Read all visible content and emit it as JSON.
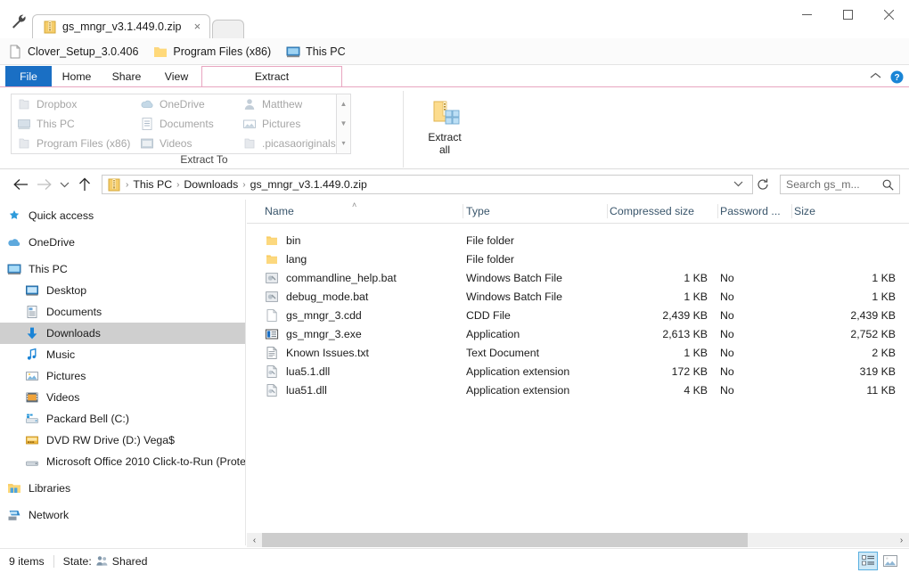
{
  "window": {
    "tab": {
      "title": "gs_mngr_v3.1.449.0.zip",
      "icon": "zip-icon",
      "close_label": "×"
    },
    "tools_icon": "wrench-icon",
    "new_tab_label": "",
    "controls": {
      "minimize": "minimize-icon",
      "maximize": "maximize-icon",
      "close": "close-icon"
    }
  },
  "bookmarks": [
    {
      "label": "Clover_Setup_3.0.406",
      "icon": "file-icon"
    },
    {
      "label": "Program Files (x86)",
      "icon": "folder-icon"
    },
    {
      "label": "This PC",
      "icon": "computer-icon"
    }
  ],
  "ribbon": {
    "tabs": [
      {
        "label": "File",
        "active": false,
        "style": "file"
      },
      {
        "label": "Home",
        "active": false,
        "style": "normal"
      },
      {
        "label": "Share",
        "active": false,
        "style": "normal"
      },
      {
        "label": "View",
        "active": false,
        "style": "normal"
      },
      {
        "label": "Extract",
        "active": true,
        "style": "contextual"
      }
    ],
    "collapse_icon": "chevron-up-icon",
    "help_icon": "help-icon",
    "groups": [
      {
        "name": "extract-to",
        "label": "Extract To",
        "items": [
          {
            "label": "Dropbox",
            "icon": "folder-grey-icon"
          },
          {
            "label": "OneDrive",
            "icon": "onedrive-icon"
          },
          {
            "label": "Matthew",
            "icon": "user-icon"
          },
          {
            "label": "This PC",
            "icon": "computer-icon"
          },
          {
            "label": "Documents",
            "icon": "documents-icon"
          },
          {
            "label": "Pictures",
            "icon": "pictures-icon"
          },
          {
            "label": "Program Files (x86)",
            "icon": "folder-grey-icon"
          },
          {
            "label": "Videos",
            "icon": "videos-icon"
          },
          {
            "label": ".picasaoriginals",
            "icon": "folder-grey-icon"
          }
        ],
        "scroll_up": "▲",
        "scroll_down": "▼",
        "scroll_more": "▾"
      },
      {
        "name": "extract-all",
        "button": {
          "line1": "Extract",
          "line2": "all",
          "icon": "extract-all-icon"
        }
      }
    ]
  },
  "address": {
    "back_icon": "arrow-left-icon",
    "forward_icon": "arrow-right-icon",
    "history_icon": "chevron-down-icon",
    "up_icon": "arrow-up-icon",
    "path_icon": "zip-icon",
    "breadcrumbs": [
      "This PC",
      "Downloads",
      "gs_mngr_v3.1.449.0.zip"
    ],
    "separator": "›",
    "dropdown_icon": "chevron-down-icon",
    "refresh_icon": "refresh-icon",
    "search": {
      "placeholder": "Search gs_m...",
      "icon": "search-icon"
    }
  },
  "navpane": [
    {
      "label": "Quick access",
      "icon": "star-pin-icon",
      "indent": false,
      "selected": false
    },
    {
      "gap": true
    },
    {
      "label": "OneDrive",
      "icon": "onedrive-icon",
      "indent": false,
      "selected": false
    },
    {
      "gap": true
    },
    {
      "label": "This PC",
      "icon": "computer-icon",
      "indent": false,
      "selected": false
    },
    {
      "label": "Desktop",
      "icon": "desktop-icon",
      "indent": true,
      "selected": false
    },
    {
      "label": "Documents",
      "icon": "documents-icon",
      "indent": true,
      "selected": false
    },
    {
      "label": "Downloads",
      "icon": "downloads-icon",
      "indent": true,
      "selected": true
    },
    {
      "label": "Music",
      "icon": "music-icon",
      "indent": true,
      "selected": false
    },
    {
      "label": "Pictures",
      "icon": "pictures-icon",
      "indent": true,
      "selected": false
    },
    {
      "label": "Videos",
      "icon": "videos-icon",
      "indent": true,
      "selected": false
    },
    {
      "label": "Packard Bell (C:)",
      "icon": "drive-icon",
      "indent": true,
      "selected": false
    },
    {
      "label": "DVD RW Drive (D:) Vega$",
      "icon": "dvd-icon",
      "indent": true,
      "selected": false
    },
    {
      "label": "Microsoft Office 2010 Click-to-Run (Prote",
      "icon": "drive-grey-icon",
      "indent": true,
      "selected": false
    },
    {
      "gap": true
    },
    {
      "label": "Libraries",
      "icon": "libraries-icon",
      "indent": false,
      "selected": false
    },
    {
      "gap": true
    },
    {
      "label": "Network",
      "icon": "network-icon",
      "indent": false,
      "selected": false
    }
  ],
  "filelist": {
    "columns": [
      "Name",
      "Type",
      "Compressed size",
      "Password ...",
      "Size"
    ],
    "sort_indicator": "˄",
    "rows": [
      {
        "name": "bin",
        "icon": "folder-icon",
        "type": "File folder",
        "compressed": "",
        "password": "",
        "size": ""
      },
      {
        "name": "lang",
        "icon": "folder-icon",
        "type": "File folder",
        "compressed": "",
        "password": "",
        "size": ""
      },
      {
        "name": "commandline_help.bat",
        "icon": "bat-icon",
        "type": "Windows Batch File",
        "compressed": "1 KB",
        "password": "No",
        "size": "1 KB"
      },
      {
        "name": "debug_mode.bat",
        "icon": "bat-icon",
        "type": "Windows Batch File",
        "compressed": "1 KB",
        "password": "No",
        "size": "1 KB"
      },
      {
        "name": "gs_mngr_3.cdd",
        "icon": "blank-file-icon",
        "type": "CDD File",
        "compressed": "2,439 KB",
        "password": "No",
        "size": "2,439 KB"
      },
      {
        "name": "gs_mngr_3.exe",
        "icon": "exe-icon",
        "type": "Application",
        "compressed": "2,613 KB",
        "password": "No",
        "size": "2,752 KB"
      },
      {
        "name": "Known Issues.txt",
        "icon": "text-icon",
        "type": "Text Document",
        "compressed": "1 KB",
        "password": "No",
        "size": "2 KB"
      },
      {
        "name": "lua5.1.dll",
        "icon": "dll-icon",
        "type": "Application extension",
        "compressed": "172 KB",
        "password": "No",
        "size": "319 KB"
      },
      {
        "name": "lua51.dll",
        "icon": "dll-icon",
        "type": "Application extension",
        "compressed": "4 KB",
        "password": "No",
        "size": "11 KB"
      }
    ],
    "hscroll": {
      "left_arrow": "‹",
      "right_arrow": "›"
    }
  },
  "statusbar": {
    "item_count": "9 items",
    "state_label": "State:",
    "state_value": "Shared",
    "state_icon": "shared-people-icon",
    "views": [
      {
        "name": "details-view",
        "icon": "details-view-icon",
        "active": true
      },
      {
        "name": "large-icons-view",
        "icon": "large-icons-view-icon",
        "active": false
      }
    ]
  }
}
